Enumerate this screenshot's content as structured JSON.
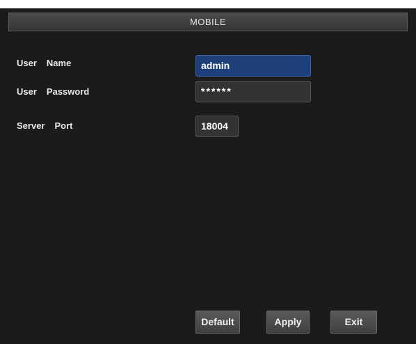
{
  "window": {
    "title": "MOBILE"
  },
  "form": {
    "user_name": {
      "label_first": "User",
      "label_second": "Name",
      "value": "admin"
    },
    "user_password": {
      "label_first": "User",
      "label_second": "Password",
      "value": "******"
    },
    "server_port": {
      "label_first": "Server",
      "label_second": "Port",
      "value": "18004"
    }
  },
  "buttons": {
    "default_label": "Default",
    "apply_label": "Apply",
    "exit_label": "Exit"
  },
  "colors": {
    "background": "#1b1b1b",
    "titlebar": "#404040",
    "selected_field": "#1d3f7a",
    "field": "#333333",
    "text": "#e8e8e8"
  }
}
